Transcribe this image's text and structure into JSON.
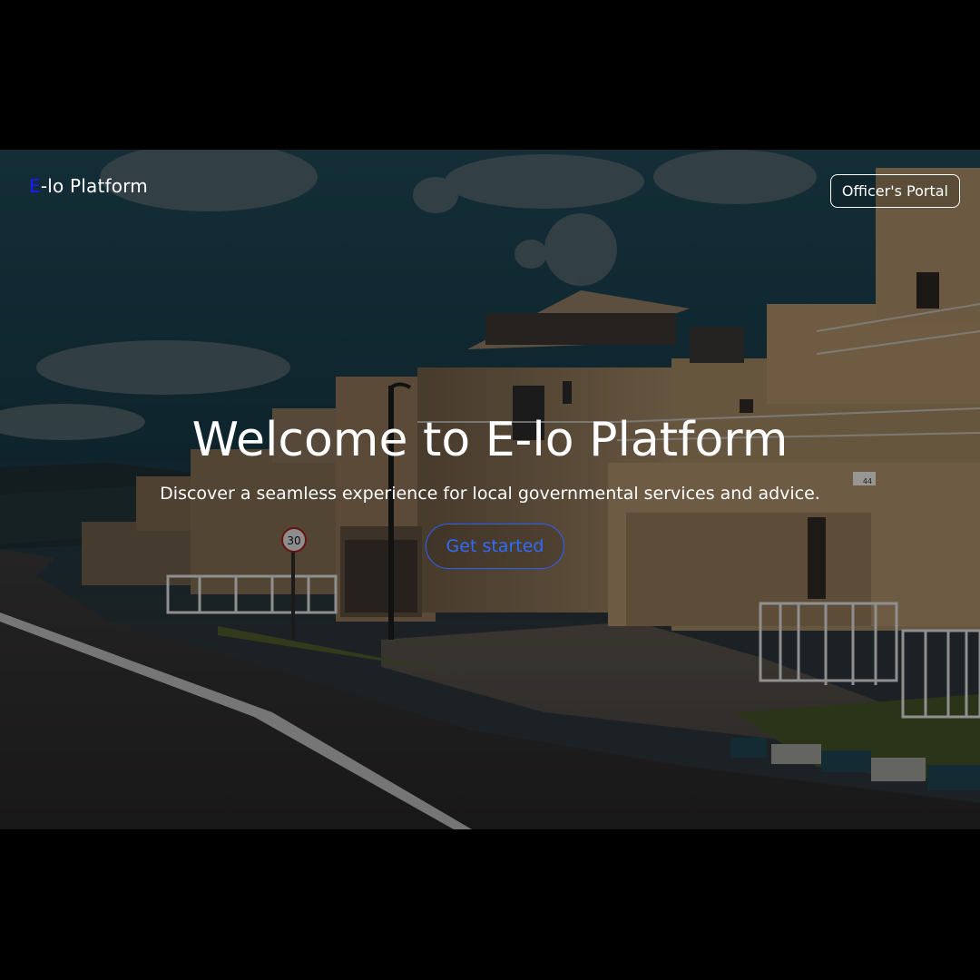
{
  "brand": {
    "accent_letter": "E",
    "rest": "-lo Platform"
  },
  "header": {
    "officer_portal_label": "Officer's Portal"
  },
  "hero": {
    "title": "Welcome to E-lo Platform",
    "subtitle": "Discover a seamless experience for local governmental services and advice.",
    "cta_label": "Get started"
  },
  "scene": {
    "speed_sign": "30",
    "house_number": "44"
  },
  "colors": {
    "accent": "#1a1aff",
    "cta": "#2f6bff",
    "page_background": "#000000"
  }
}
